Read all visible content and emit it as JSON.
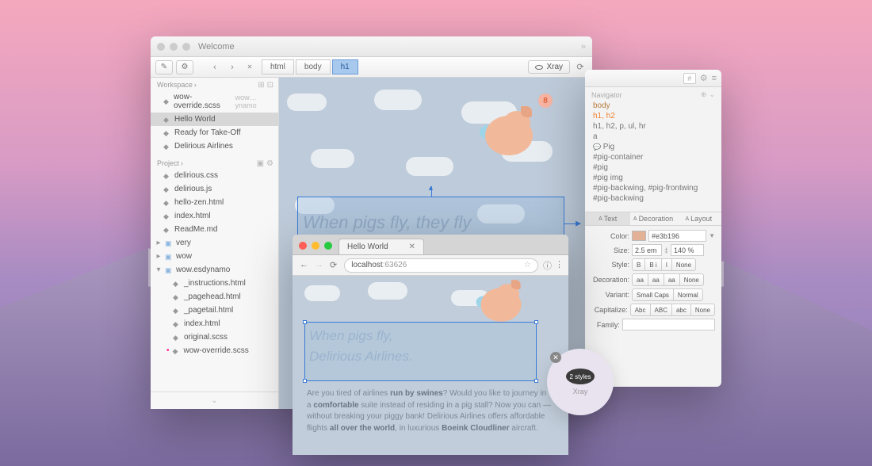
{
  "editor": {
    "title": "Welcome",
    "breadcrumbs": [
      "html",
      "body",
      "h1"
    ],
    "xray_label": "Xray",
    "workspace": {
      "heading": "Workspace",
      "items": [
        {
          "icon": "scss",
          "name": "wow-override.scss",
          "suffix": "wow…ynamo"
        },
        {
          "icon": "doc",
          "name": "Hello World",
          "selected": true
        },
        {
          "icon": "doc",
          "name": "Ready for Take-Off"
        },
        {
          "icon": "doc",
          "name": "Delirious Airlines"
        }
      ]
    },
    "project": {
      "heading": "Project",
      "items": [
        {
          "icon": "css",
          "name": "delirious.css"
        },
        {
          "icon": "js",
          "name": "delirious.js"
        },
        {
          "icon": "html",
          "name": "hello-zen.html"
        },
        {
          "icon": "html",
          "name": "index.html"
        },
        {
          "icon": "md",
          "name": "ReadMe.md"
        },
        {
          "icon": "folder",
          "name": "very",
          "collapsed": true
        },
        {
          "icon": "folder",
          "name": "wow",
          "collapsed": true
        },
        {
          "icon": "folder",
          "name": "wow.esdynamo",
          "collapsed": false,
          "children": [
            {
              "icon": "html",
              "name": "_instructions.html"
            },
            {
              "icon": "html",
              "name": "_pagehead.html"
            },
            {
              "icon": "html",
              "name": "_pagetail.html"
            },
            {
              "icon": "html",
              "name": "index.html"
            },
            {
              "icon": "scss",
              "name": "original.scss"
            },
            {
              "icon": "scss",
              "name": "wow-override.scss",
              "marked": true
            }
          ]
        }
      ]
    },
    "canvas": {
      "headline": "When pigs fly, they fly",
      "badge": "8"
    }
  },
  "browser": {
    "tab_title": "Hello World",
    "url_host": "localhost",
    "url_port": ":63626",
    "headline_l1": "When pigs fly,",
    "headline_l2": "Delirious Airlines.",
    "body_html": "Are you tired of airlines <strong>run by swines</strong>? Would you like to journey in a <strong>comfortable</strong> suite instead of residing in a pig stall? Now you can — without breaking your piggy bank! Delirious Airlines offers affordable flights <strong>all over the world</strong>, in luxurious <strong>Boeink Cloudliner</strong> aircraft."
  },
  "inspector": {
    "hash": "#",
    "navigator_title": "Navigator",
    "rules": [
      {
        "label": "body",
        "class": "body"
      },
      {
        "label": "h1, h2",
        "class": "selected"
      },
      {
        "label": "h1, h2, p, ul, hr"
      },
      {
        "label": "a"
      },
      {
        "label": "Pig",
        "pig": true
      },
      {
        "label": "#pig-container"
      },
      {
        "label": "#pig"
      },
      {
        "label": "#pig img"
      },
      {
        "label": "#pig-backwing, #pig-frontwing"
      },
      {
        "label": "#pig-backwing"
      }
    ],
    "tabs": [
      "Text",
      "Decoration",
      "Layout"
    ],
    "active_tab": 0,
    "props": {
      "color_label": "Color:",
      "color_hex": "#e3b196",
      "size_label": "Size:",
      "size": "2.5 em",
      "line_height": "140 %",
      "style_label": "Style:",
      "style_btns": [
        "B",
        "B i",
        "I",
        "None"
      ],
      "deco_label": "Decoration:",
      "deco_btns": [
        "aa",
        "aa",
        "aa",
        "None"
      ],
      "variant_label": "Variant:",
      "variant_btns": [
        "Small Caps",
        "Normal"
      ],
      "cap_label": "Capitalize:",
      "cap_btns": [
        "Abc",
        "ABC",
        "abc",
        "None"
      ],
      "family_label": "Family:"
    }
  },
  "xray_badge": {
    "count": "2 styles",
    "label": "Xray"
  }
}
